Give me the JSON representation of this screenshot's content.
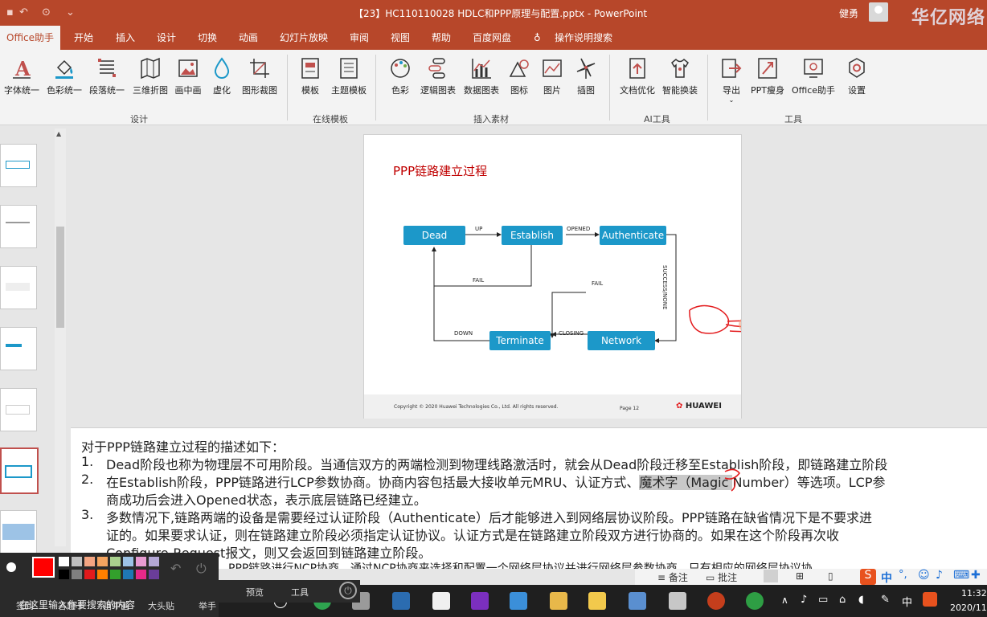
{
  "window": {
    "title": "【23】HC110110028 HDLC和PPP原理与配置.pptx  -  PowerPoint",
    "user": "健勇",
    "watermark": "华亿网络"
  },
  "tabs": [
    "Office助手",
    "开始",
    "插入",
    "设计",
    "切换",
    "动画",
    "幻灯片放映",
    "审阅",
    "视图",
    "帮助",
    "百度网盘",
    "操作说明搜索"
  ],
  "ribbon": {
    "design_buttons": [
      "字体统一",
      "色彩统一",
      "段落统一",
      "三维折图",
      "画中画",
      "虚化",
      "图形裁图"
    ],
    "design_group": "设计",
    "template_buttons": [
      "模板",
      "主题模板"
    ],
    "template_group": "在线模板",
    "material_buttons": [
      "色彩",
      "逻辑图表",
      "数据图表",
      "图标",
      "图片",
      "插图"
    ],
    "material_group": "插入素材",
    "ai_buttons": [
      "文档优化",
      "智能换装"
    ],
    "ai_group": "AI工具",
    "tool_buttons": [
      "导出",
      "PPT瘦身",
      "Office助手",
      "设置"
    ],
    "tool_group": "工具"
  },
  "slide": {
    "title": "PPP链路建立过程",
    "states": {
      "dead": "Dead",
      "establish": "Establish",
      "authenticate": "Authenticate",
      "terminate": "Terminate",
      "network": "Network"
    },
    "edges": {
      "up": "UP",
      "opened": "OPENED",
      "fail1": "FAIL",
      "fail2": "FAIL",
      "success": "SUCCESS/NONE",
      "down": "DOWN",
      "closing": "CLOSING"
    },
    "copyright": "Copyright © 2020 Huawei Technologies Co., Ltd. All rights reserved.",
    "page": "Page 12",
    "logo": "HUAWEI"
  },
  "notes": {
    "intro": "对于PPP链路建立过程的描述如下：",
    "item1_num": "1.",
    "item1": "Dead阶段也称为物理层不可用阶段。当通信双方的两端检测到物理线路激活时，就会从Dead阶段迁移至Establish阶段，即链路建立阶段",
    "item2_num": "2.",
    "item2_a": "在Establish阶段，PPP链路进行LCP参数协商。协商内容包括最大接收单元MRU、认证方式、",
    "item2_hl": "魔术字（Magic ",
    "item2_b": "Number）等选项。LCP参",
    "item2_cont": "商成功后会进入Opened状态，表示底层链路已经建立。",
    "item3_num": "3.",
    "item3": "多数情况下,链路两端的设备是需要经过认证阶段（Authenticate）后才能够进入到网络层协议阶段。PPP链路在缺省情况下是不要求进",
    "item3_cont1": "证的。如果要求认证，则在链路建立阶段必须指定认证协议。认证方式是在链路建立阶段双方进行协商的。如果在这个阶段再次收",
    "item3_cont2": "Configure-Request报文，则又会返回到链路建立阶段。",
    "item4": "PPP链路进行NCP协商，通过NCP协商来选择和配置一个网络层协议并进行网络层参数协商。只有相应的网络层协议协"
  },
  "status": {
    "notes_btn": "备注",
    "comments_btn": "批注"
  },
  "palette": {
    "tools": [
      "签到",
      "答题卡",
      "画中画",
      "大头贴",
      "举手",
      "预览",
      "工具"
    ],
    "colors": [
      "#ffffff",
      "#c0c0c0",
      "#f4a582",
      "#f4a460",
      "#a9d18e",
      "#9dc3e6",
      "#e89bd2",
      "#b4a7d6",
      "#000000",
      "#808080",
      "#e31a1c",
      "#ff7f00",
      "#33a02c",
      "#1f78b4",
      "#e7298a",
      "#6a3d9a"
    ],
    "current_color": "#ff0000",
    "search_hint": "在这里输入你要搜索的内容"
  },
  "clock": {
    "time": "11:32",
    "date": "2020/11"
  },
  "ime": "中"
}
